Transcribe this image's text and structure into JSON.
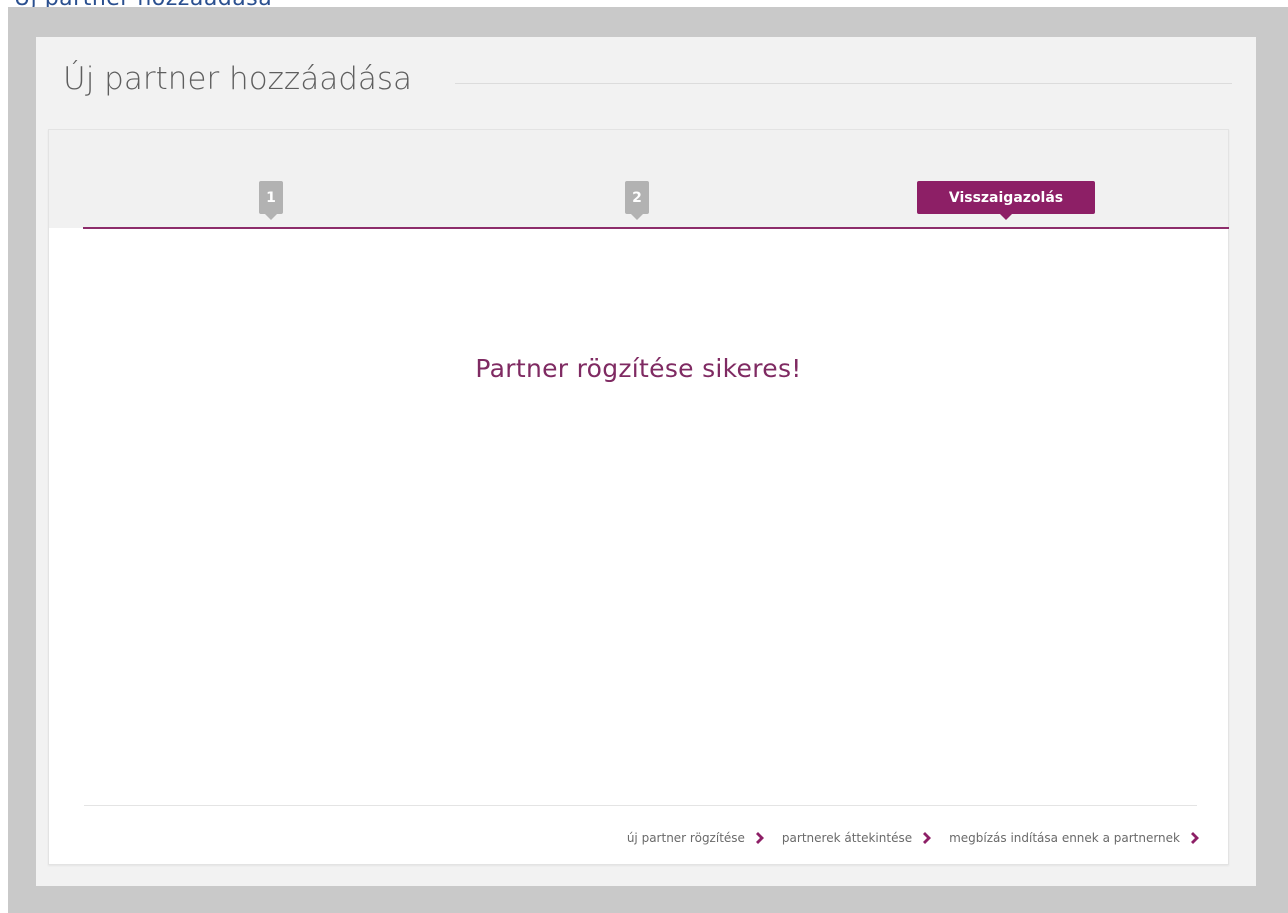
{
  "page": {
    "title": "Új partner hozzáadása"
  },
  "steps": [
    {
      "label": "1",
      "state": "done"
    },
    {
      "label": "2",
      "state": "done"
    },
    {
      "label": "Visszaigazolás",
      "state": "active"
    }
  ],
  "message": {
    "text": "Partner rögzítése sikeres!"
  },
  "footer": {
    "links": [
      {
        "label": "új partner rögzítése"
      },
      {
        "label": "partnerek áttekintése"
      },
      {
        "label": "megbízás indítása ennek a partnernek"
      }
    ]
  },
  "colors": {
    "accent": "#8d1f66",
    "message": "#7f2a62",
    "inactive_step": "#b2b2b2",
    "frame": "#c9c9c9"
  },
  "icons": {
    "footer_link_icon": "chevron-right-icon"
  }
}
